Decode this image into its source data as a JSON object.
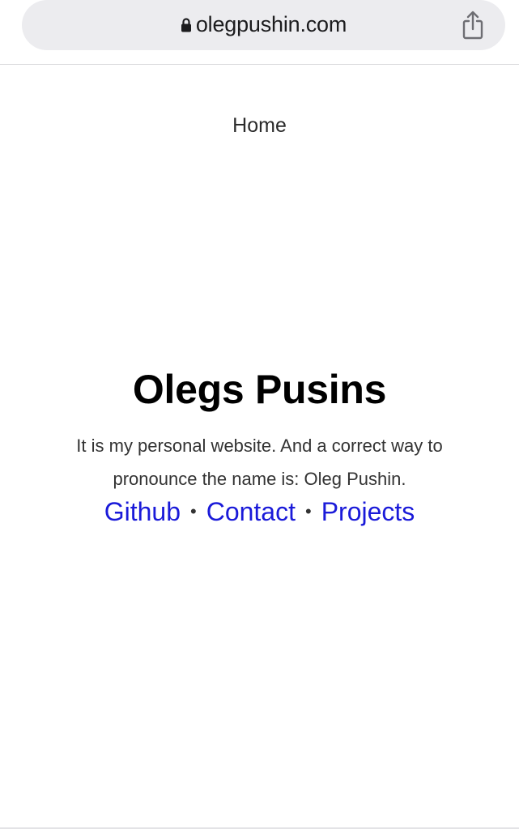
{
  "browser": {
    "url": "olegpushin.com",
    "lock_icon": "lock-icon",
    "share_icon": "share-icon"
  },
  "nav": {
    "home_label": "Home"
  },
  "main": {
    "title": "Olegs Pusins",
    "intro": "It is my personal website. And a correct way to pronounce the name is: Oleg Pushin.",
    "links": [
      {
        "label": "Github"
      },
      {
        "label": "Contact"
      },
      {
        "label": "Projects"
      }
    ],
    "separator": "•"
  },
  "colors": {
    "link": "#1a1ad9",
    "text": "#333333",
    "title": "#000000",
    "url_bar": "#ececef"
  }
}
